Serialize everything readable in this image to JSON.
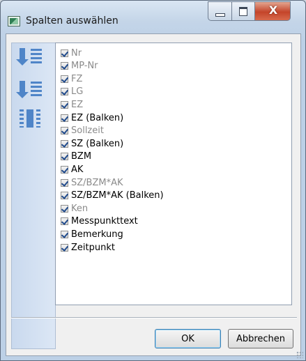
{
  "window": {
    "title": "Spalten auswählen",
    "controls": {
      "minimize": "minimize",
      "maximize": "maximize",
      "close": "X"
    }
  },
  "toolbar": {
    "items": [
      {
        "name": "sort-descending",
        "icon": "sort-descending-icon"
      },
      {
        "name": "sort-ascending",
        "icon": "sort-ascending-icon"
      },
      {
        "name": "move-columns",
        "icon": "move-columns-icon"
      }
    ]
  },
  "columns": [
    {
      "label": "Nr",
      "checked": true,
      "enabled": false
    },
    {
      "label": "MP-Nr",
      "checked": true,
      "enabled": false
    },
    {
      "label": "FZ",
      "checked": true,
      "enabled": false
    },
    {
      "label": "LG",
      "checked": true,
      "enabled": false
    },
    {
      "label": "EZ",
      "checked": true,
      "enabled": false
    },
    {
      "label": "EZ (Balken)",
      "checked": true,
      "enabled": true
    },
    {
      "label": "Sollzeit",
      "checked": true,
      "enabled": false
    },
    {
      "label": "SZ (Balken)",
      "checked": true,
      "enabled": true
    },
    {
      "label": "BZM",
      "checked": true,
      "enabled": true
    },
    {
      "label": "AK",
      "checked": true,
      "enabled": true
    },
    {
      "label": "SZ/BZM*AK",
      "checked": true,
      "enabled": false
    },
    {
      "label": "SZ/BZM*AK (Balken)",
      "checked": true,
      "enabled": true
    },
    {
      "label": "Ken",
      "checked": true,
      "enabled": false
    },
    {
      "label": "Messpunkttext",
      "checked": true,
      "enabled": true
    },
    {
      "label": "Bemerkung",
      "checked": true,
      "enabled": true
    },
    {
      "label": "Zeitpunkt",
      "checked": true,
      "enabled": true
    }
  ],
  "buttons": {
    "ok": "OK",
    "cancel": "Abbrechen"
  },
  "colors": {
    "accent": "#4f85c8",
    "disabled_text": "#8a8a8a"
  }
}
